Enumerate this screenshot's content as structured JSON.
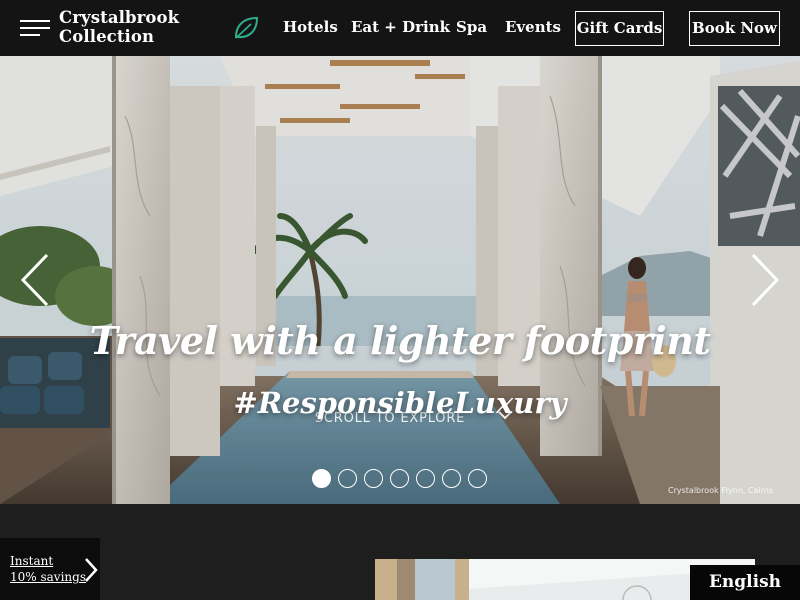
{
  "header": {
    "logo_line1": "Crystalbrook",
    "logo_line2": "Collection",
    "nav": {
      "hotels": "Hotels",
      "eat_drink": "Eat + Drink",
      "spa": "Spa",
      "events": "Events"
    },
    "gift_cards": "Gift Cards",
    "book_now": "Book Now"
  },
  "hero": {
    "title": "Travel with a lighter footprint",
    "subtitle": "#ResponsibleLuxury",
    "scroll_label": "SCROLL TO EXPLORE",
    "credit": "Crystalbrook Flynn, Cairns",
    "slide_count": 7,
    "active_slide": 1
  },
  "savings": {
    "line1": "Instant",
    "line2": "10% savings"
  },
  "language": "English",
  "colors": {
    "header_bg": "#141414",
    "page_bg": "#1e1e1e",
    "leaf_accent": "#2fae8a",
    "text": "#ffffff"
  },
  "icons": [
    "menu-icon",
    "leaf-icon",
    "chevron-left-icon",
    "chevron-right-icon",
    "chevron-down-icon"
  ]
}
